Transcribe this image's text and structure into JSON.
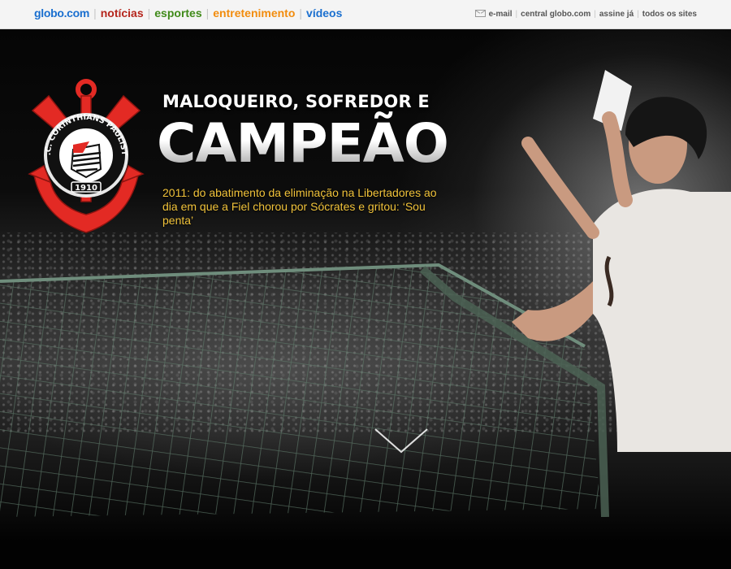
{
  "header": {
    "brand": "globo.com",
    "sections": [
      {
        "label": "notícias",
        "color": "#b5251c"
      },
      {
        "label": "esportes",
        "color": "#3f8a19"
      },
      {
        "label": "entretenimento",
        "color": "#f28c0d"
      },
      {
        "label": "vídeos",
        "color": "#1a6fcf"
      }
    ],
    "brand_color": "#1a6fcf",
    "links": {
      "email": "e-mail",
      "central": "central globo.com",
      "assine": "assine já",
      "todos": "todos os sites"
    }
  },
  "hero": {
    "kicker": "MALOQUEIRO, SOFREDOR E",
    "headline": "CAMPEÃO",
    "subtitle": "2011: do abatimento da eliminação na Libertadores ao dia em que a Fiel chorou por Sócrates e gritou: ‘Sou penta’",
    "crest": {
      "name": "S.C. CORINTHIANS PAULISTA",
      "year": "1910",
      "color": "#e32a24"
    },
    "scroll_icon": "chevron-down-icon",
    "accent": "#f0c23a"
  }
}
